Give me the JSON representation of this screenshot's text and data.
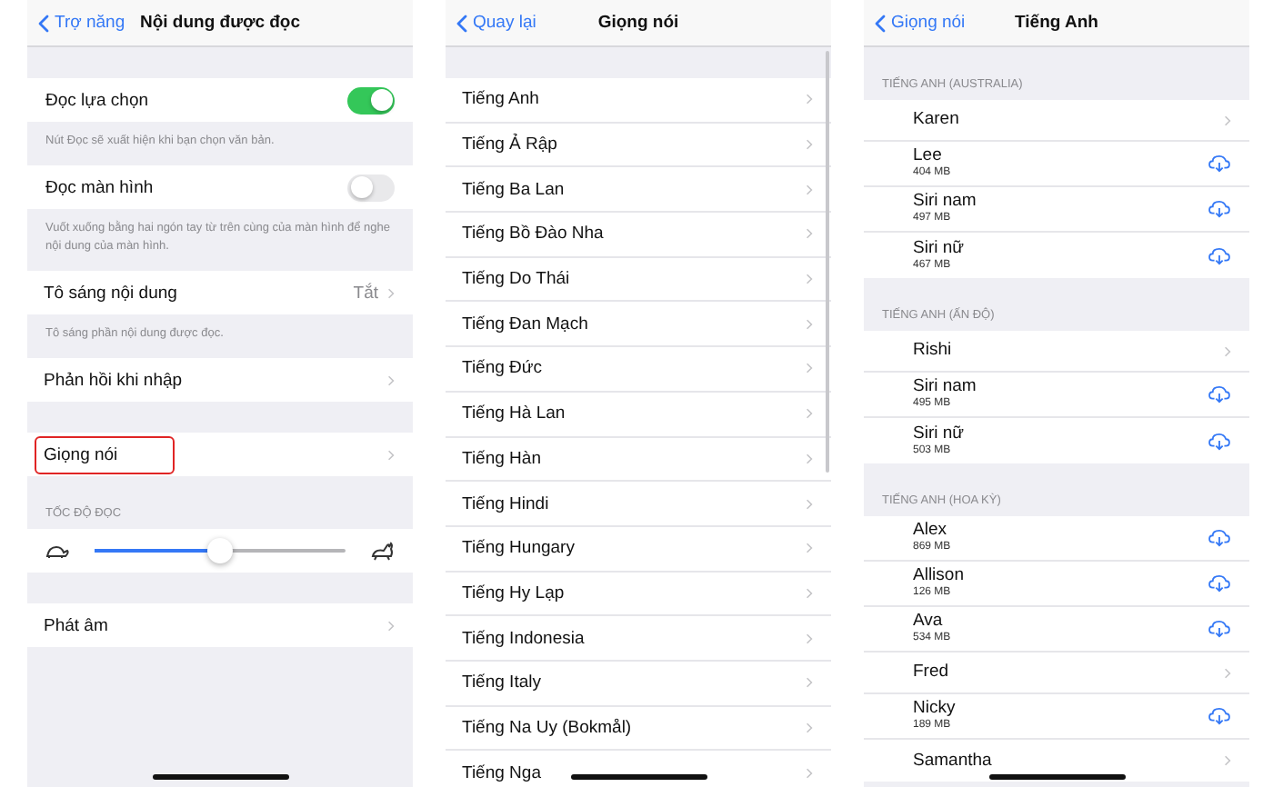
{
  "screens": [
    {
      "back": "Trợ năng",
      "title": "Nội dung được đọc",
      "groups": [
        {
          "rows": [
            {
              "kind": "toggle",
              "label": "Đọc lựa chọn",
              "on": true
            }
          ],
          "footer": "Nút Đọc sẽ xuất hiện khi bạn chọn văn bản."
        },
        {
          "rows": [
            {
              "kind": "toggle",
              "label": "Đọc màn hình",
              "on": false
            }
          ],
          "footer": "Vuốt xuống bằng hai ngón tay từ trên cùng của màn hình để nghe nội dung của màn hình."
        },
        {
          "rows": [
            {
              "kind": "link",
              "label": "Tô sáng nội dung",
              "value": "Tắt",
              "highlighted": false
            }
          ],
          "footer": "Tô sáng phần nội dung được đọc."
        },
        {
          "rows": [
            {
              "kind": "link",
              "label": "Phản hồi khi nhập",
              "highlighted": false
            }
          ]
        },
        {
          "rows": [
            {
              "kind": "link",
              "label": "Giọng nói",
              "highlighted": true
            }
          ]
        },
        {
          "header": "TỐC ĐỘ ĐỌC",
          "rows": [
            {
              "kind": "slider",
              "level": 0.5
            }
          ]
        },
        {
          "rows": [
            {
              "kind": "link",
              "label": "Phát âm",
              "highlighted": false
            }
          ]
        }
      ]
    },
    {
      "back": "Quay lại",
      "title": "Giọng nói",
      "scrollbar": true,
      "groups": [
        {
          "rows": [
            {
              "kind": "link",
              "label": "Tiếng Anh"
            },
            {
              "kind": "link",
              "label": "Tiếng Ả Rập"
            },
            {
              "kind": "link",
              "label": "Tiếng Ba Lan"
            },
            {
              "kind": "link",
              "label": "Tiếng Bồ Đào Nha"
            },
            {
              "kind": "link",
              "label": "Tiếng Do Thái"
            },
            {
              "kind": "link",
              "label": "Tiếng Đan Mạch"
            },
            {
              "kind": "link",
              "label": "Tiếng Đức"
            },
            {
              "kind": "link",
              "label": "Tiếng Hà Lan"
            },
            {
              "kind": "link",
              "label": "Tiếng Hàn"
            },
            {
              "kind": "link",
              "label": "Tiếng Hindi"
            },
            {
              "kind": "link",
              "label": "Tiếng Hungary"
            },
            {
              "kind": "link",
              "label": "Tiếng Hy Lạp"
            },
            {
              "kind": "link",
              "label": "Tiếng Indonesia"
            },
            {
              "kind": "link",
              "label": "Tiếng Italy"
            },
            {
              "kind": "link",
              "label": "Tiếng Na Uy (Bokmål)"
            },
            {
              "kind": "link",
              "label": "Tiếng Nga"
            }
          ]
        }
      ]
    },
    {
      "back": "Giọng nói",
      "title": "Tiếng Anh",
      "groups": [
        {
          "header": "TIẾNG ANH (AUSTRALIA)",
          "rows": [
            {
              "kind": "voice",
              "label": "Karen",
              "download": false
            },
            {
              "kind": "voice",
              "label": "Lee",
              "size": "404 MB",
              "download": true
            },
            {
              "kind": "voice",
              "label": "Siri nam",
              "size": "497 MB",
              "download": true
            },
            {
              "kind": "voice",
              "label": "Siri nữ",
              "size": "467 MB",
              "download": true
            }
          ]
        },
        {
          "header": "TIẾNG ANH (ẤN ĐỘ)",
          "rows": [
            {
              "kind": "voice",
              "label": "Rishi",
              "download": false
            },
            {
              "kind": "voice",
              "label": "Siri nam",
              "size": "495 MB",
              "download": true
            },
            {
              "kind": "voice",
              "label": "Siri nữ",
              "size": "503 MB",
              "download": true
            }
          ]
        },
        {
          "header": "TIẾNG ANH (HOA KỲ)",
          "rows": [
            {
              "kind": "voice",
              "label": "Alex",
              "size": "869 MB",
              "download": true
            },
            {
              "kind": "voice",
              "label": "Allison",
              "size": "126 MB",
              "download": true
            },
            {
              "kind": "voice",
              "label": "Ava",
              "size": "534 MB",
              "download": true
            },
            {
              "kind": "voice",
              "label": "Fred",
              "download": false
            },
            {
              "kind": "voice",
              "label": "Nicky",
              "size": "189 MB",
              "download": true
            },
            {
              "kind": "voice",
              "label": "Samantha",
              "download": false
            }
          ]
        }
      ]
    }
  ]
}
